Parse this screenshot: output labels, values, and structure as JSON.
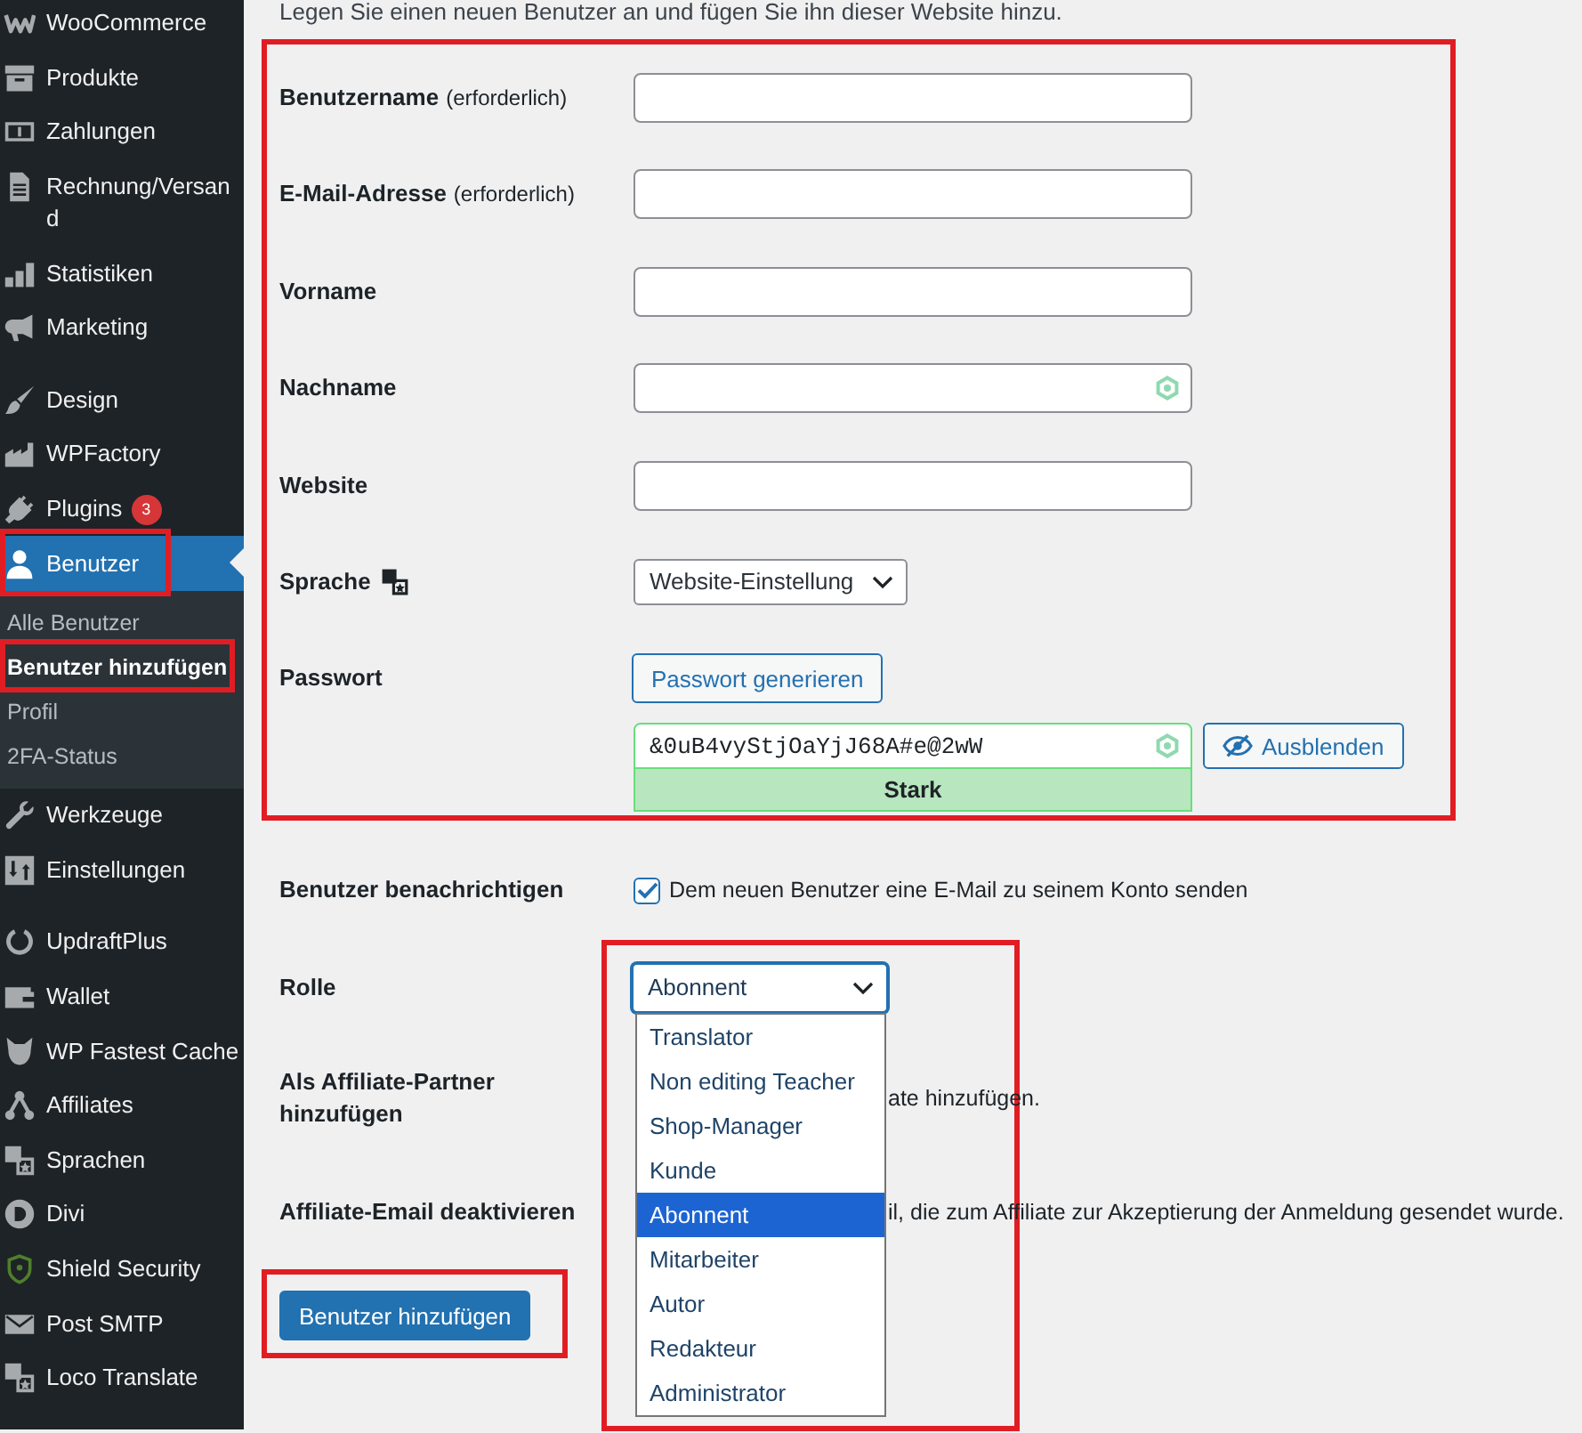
{
  "sidebar": {
    "sections": [
      {
        "items": [
          {
            "label": "WooCommerce",
            "selected": false,
            "highlighted": false
          },
          {
            "label": "Produkte",
            "selected": false,
            "highlighted": false
          },
          {
            "label": "Zahlungen",
            "selected": false,
            "highlighted": false
          },
          {
            "label": "Rechnung/Versand",
            "selected": false,
            "highlighted": false
          },
          {
            "label": "Statistiken",
            "selected": false,
            "highlighted": false
          },
          {
            "label": "Marketing",
            "selected": false,
            "highlighted": false
          }
        ]
      },
      {
        "items": [
          {
            "label": "Design",
            "selected": false,
            "highlighted": false
          },
          {
            "label": "WPFactory",
            "selected": false,
            "highlighted": false
          },
          {
            "label": "Plugins",
            "selected": false,
            "highlighted": false,
            "badge": "3"
          },
          {
            "label": "Benutzer",
            "selected": true,
            "highlighted": true,
            "children": [
              {
                "label": "Alle Benutzer",
                "selected": false,
                "highlighted": false
              },
              {
                "label": "Benutzer hinzufügen",
                "selected": true,
                "highlighted": true
              },
              {
                "label": "Profil",
                "selected": false,
                "highlighted": false
              },
              {
                "label": "2FA-Status",
                "selected": false,
                "highlighted": false
              }
            ]
          },
          {
            "label": "Werkzeuge",
            "selected": false,
            "highlighted": false
          },
          {
            "label": "Einstellungen",
            "selected": false,
            "highlighted": false
          }
        ]
      },
      {
        "items": [
          {
            "label": "UpdraftPlus",
            "selected": false,
            "highlighted": false
          },
          {
            "label": "Wallet",
            "selected": false,
            "highlighted": false
          },
          {
            "label": "WP Fastest Cache",
            "selected": false,
            "highlighted": false
          },
          {
            "label": "Affiliates",
            "selected": false,
            "highlighted": false
          },
          {
            "label": "Sprachen",
            "selected": false,
            "highlighted": false
          },
          {
            "label": "Divi",
            "selected": false,
            "highlighted": false
          },
          {
            "label": "Shield Security",
            "selected": false,
            "highlighted": false
          },
          {
            "label": "Post SMTP",
            "selected": false,
            "highlighted": false
          },
          {
            "label": "Loco Translate",
            "selected": false,
            "highlighted": false
          }
        ]
      }
    ]
  },
  "intro": "Legen Sie einen neuen Benutzer an und fügen Sie ihn dieser Website hinzu.",
  "form": {
    "groups": [
      {
        "highlighted": true,
        "rows": [
          {
            "kind": "text",
            "label": "Benutzername",
            "note": "(erforderlich)",
            "highlighted": false
          },
          {
            "kind": "text",
            "label": "E-Mail-Adresse",
            "note": "(erforderlich)",
            "highlighted": false
          },
          {
            "kind": "text",
            "label": "Vorname",
            "highlighted": false
          },
          {
            "kind": "text",
            "label": "Nachname",
            "autofill_icon": true,
            "highlighted": false
          },
          {
            "kind": "text",
            "label": "Website",
            "highlighted": false
          },
          {
            "kind": "select",
            "label": "Sprache",
            "label_icon": true,
            "value": "Website-Einstellung",
            "highlighted": false
          },
          {
            "kind": "password",
            "label": "Passwort",
            "generate_button": "Passwort generieren",
            "value": "&0uB4vyStjOaYjJ68A#e@2wW",
            "autofill_icon": true,
            "strength": {
              "label": "Stark",
              "kind": "strong"
            },
            "toggle_button": "Ausblenden",
            "highlighted": false
          }
        ]
      },
      {
        "highlighted": false,
        "rows": [
          {
            "kind": "checkbox",
            "label": "Benutzer benachrichtigen",
            "checked": true,
            "text": "Dem neuen Benutzer eine E-Mail zu seinem Konto senden",
            "highlighted": false
          },
          {
            "kind": "dropdown",
            "label": "Rolle",
            "value": "Abonnent",
            "focused": true,
            "expanded": true,
            "highlighted": true,
            "options": [
              {
                "label": "Translator",
                "selected": false
              },
              {
                "label": "Non editing Teacher",
                "selected": false
              },
              {
                "label": "Shop-Manager",
                "selected": false
              },
              {
                "label": "Kunde",
                "selected": false
              },
              {
                "label": "Abonnent",
                "selected": true
              },
              {
                "label": "Mitarbeiter",
                "selected": false
              },
              {
                "label": "Autor",
                "selected": false
              },
              {
                "label": "Redakteur",
                "selected": false
              },
              {
                "label": "Administrator",
                "selected": false
              }
            ]
          },
          {
            "kind": "covered",
            "label": "Als Affiliate-Partner hinzufügen",
            "text": "ate hinzufügen.",
            "highlighted": false
          },
          {
            "kind": "covered",
            "label": "Affiliate-Email deaktivieren",
            "text": "il, die zum Affiliate zur Akzeptierung der Anmeldung gesendet wurde.",
            "highlighted": false
          }
        ]
      }
    ],
    "submit": {
      "label": "Benutzer hinzufügen",
      "highlighted": true
    }
  }
}
